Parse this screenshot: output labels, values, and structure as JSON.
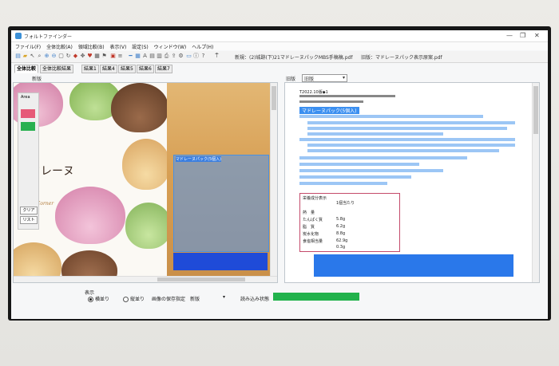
{
  "window": {
    "title": "フォルトファインダー",
    "controls": [
      "—",
      "❐",
      "✕"
    ]
  },
  "menu": [
    "ファイル(F)",
    "全体比較(A)",
    "領域比較(B)",
    "表示(V)",
    "設定(S)",
    "ウィンドウ(W)",
    "ヘルプ(H)"
  ],
  "toolbar": {
    "new_file": "新規：(2)城跡(下)21マドレーヌパックMBS手稿稿.pdf",
    "old_file": "旧版：マドレーヌパック表示原案.pdf"
  },
  "tabs": [
    "全体比較",
    "全体比較結果",
    "結果1",
    "結果4",
    "結果5",
    "結果6",
    "結果7"
  ],
  "left_panel": {
    "header": "新版",
    "area_label": "Area",
    "swatch_colors": [
      "#e65a78",
      "#28b050"
    ],
    "clear_button": "クリア",
    "list_button": "リスト",
    "product_title": "マドレーヌ",
    "brand": "CozyCorner",
    "label_highlight": "マドレーヌパック(5個入)"
  },
  "right_panel": {
    "header": "旧版",
    "select_value": "旧版",
    "code": "T2022.10版◆1",
    "section_title": "マドレーヌパック(5個入)",
    "nutrition_title": "栄養成分表示",
    "nutrition_cols": [
      "1個当たり",
      "",
      ""
    ],
    "nutrition_rows": [
      "熱　量",
      "たんぱく質",
      "脂　質",
      "炭水化物",
      "食塩相当量"
    ],
    "nutrition_values": [
      "5.8g",
      "6.2g",
      "8.8g",
      "62.9g",
      "0.3g"
    ]
  },
  "bottom": {
    "display_label": "表示",
    "radio_horizontal": "横並り",
    "radio_vertical": "縦並り",
    "save_label": "画像の保存指定",
    "save_value": "新版",
    "progress_label": "読み込み状態",
    "progress_color": "#22b24c",
    "progress_value": 1.0
  }
}
